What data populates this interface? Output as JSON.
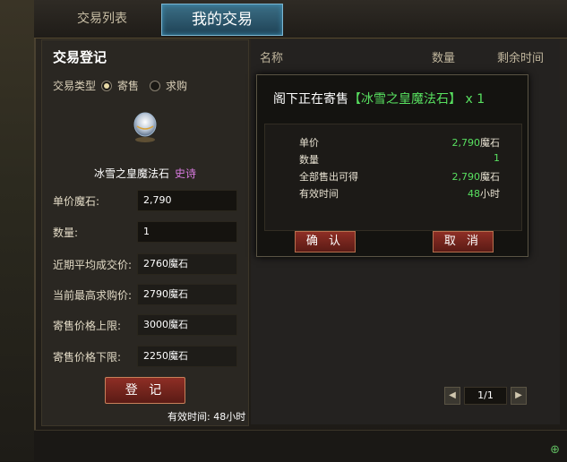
{
  "tabs": {
    "list": "交易列表",
    "mine": "我的交易"
  },
  "register": {
    "title": "交易登记",
    "type_label": "交易类型",
    "type_sell": "寄售",
    "type_buy": "求购",
    "item_name": "冰雪之皇魔法石",
    "item_quality": "史诗",
    "fields": [
      {
        "label": "单价魔石:",
        "value": "2,790"
      },
      {
        "label": "数量:",
        "value": "1"
      },
      {
        "label": "近期平均成交价:",
        "value": "2760魔石"
      },
      {
        "label": "当前最高求购价:",
        "value": "2790魔石"
      },
      {
        "label": "寄售价格上限:",
        "value": "3000魔石"
      },
      {
        "label": "寄售价格下限:",
        "value": "2250魔石"
      }
    ],
    "submit": "登 记",
    "validity": "有效时间: 48小时"
  },
  "list_headers": {
    "name": "名称",
    "qty": "数量",
    "time": "剩余时间"
  },
  "pager": {
    "prev": "◀",
    "page": "1/1",
    "next": "▶"
  },
  "dialog": {
    "prefix": "阁下正在寄售",
    "item": "【冰雪之皇魔法石】",
    "count": "x 1",
    "rows": [
      {
        "label": "单价",
        "value": "2,790",
        "unit": "魔石"
      },
      {
        "label": "数量",
        "value": "1",
        "unit": ""
      },
      {
        "label": "全部售出可得",
        "value": "2,790",
        "unit": "魔石"
      },
      {
        "label": "有效时间",
        "value": "48",
        "unit": "小时"
      }
    ],
    "confirm": "确 认",
    "cancel": "取 消"
  }
}
